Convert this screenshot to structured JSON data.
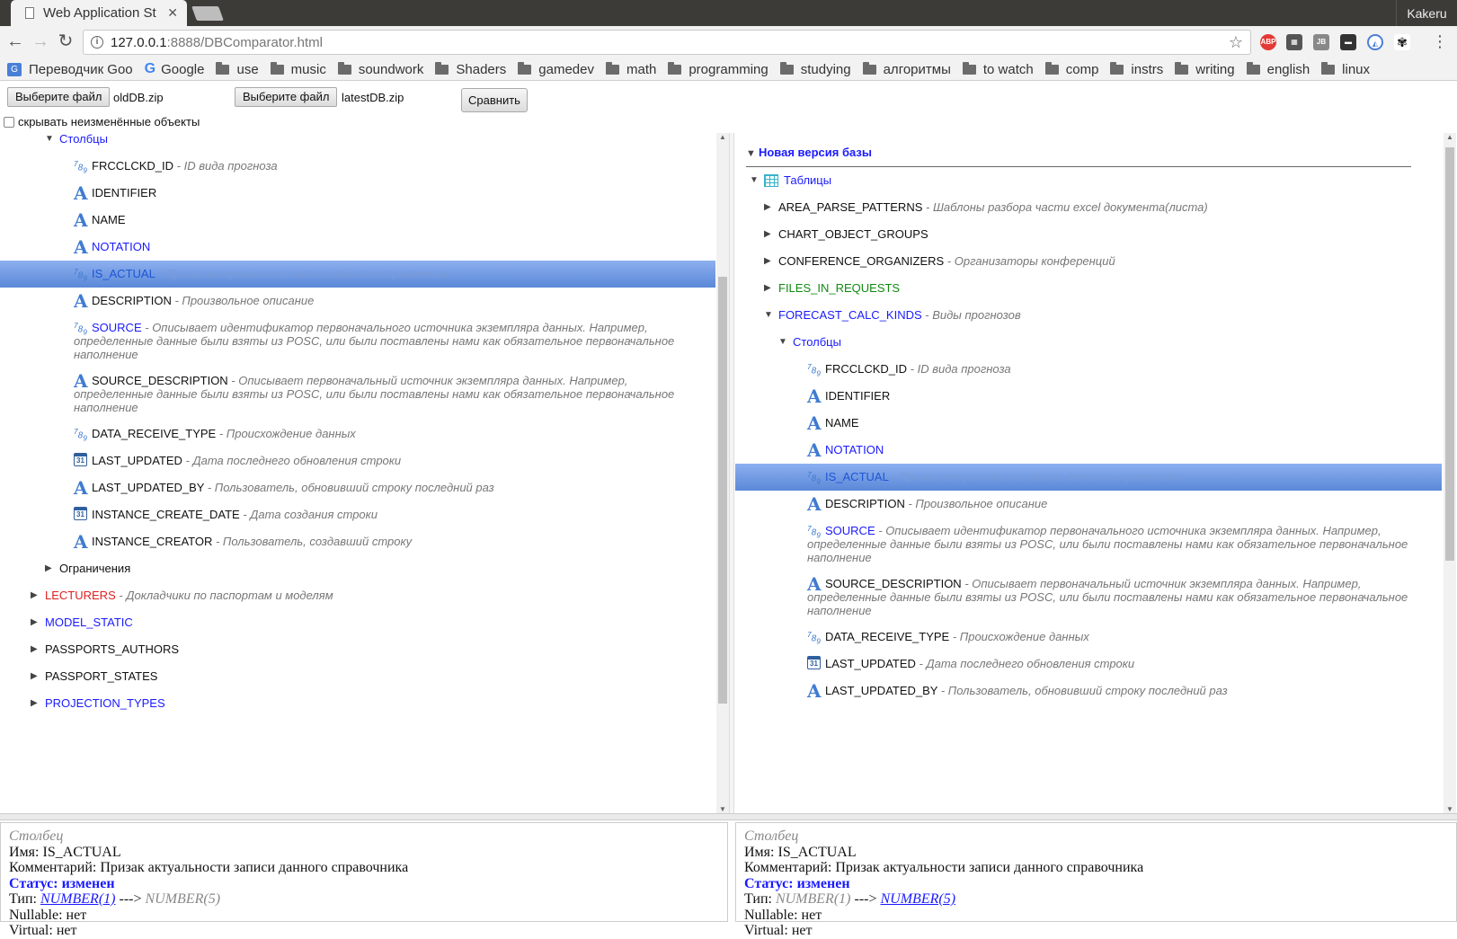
{
  "browser": {
    "tab_title": "Web Application St",
    "profile": "Kakeru",
    "url_host": "127.0.0.1",
    "url_rest": ":8888/DBComparator.html",
    "bookmarks": [
      "Переводчик Goo",
      "Google",
      "use",
      "music",
      "soundwork",
      "Shaders",
      "gamedev",
      "math",
      "programming",
      "studying",
      "алгоритмы",
      "to watch",
      "comp",
      "instrs",
      "writing",
      "english",
      "linux"
    ]
  },
  "controls": {
    "choose_file_1": "Выберите файл",
    "file_1": "oldDB.zip",
    "choose_file_2": "Выберите файл",
    "file_2": "latestDB.zip",
    "compare": "Сравнить",
    "hide_unchanged": "скрывать неизменённые объекты"
  },
  "left_tree": {
    "columns_folder": "Столбцы",
    "columns": [
      {
        "icon": "num",
        "name": "FRCCLCKD_ID",
        "comment": "- ID вида прогноза"
      },
      {
        "icon": "A",
        "name": "IDENTIFIER",
        "comment": ""
      },
      {
        "icon": "A",
        "name": "NAME",
        "comment": ""
      },
      {
        "icon": "A",
        "name": "NOTATION",
        "comment": ""
      },
      {
        "icon": "num",
        "name": "IS_ACTUAL",
        "comment": "- Призак актуальности записи данного справочника"
      },
      {
        "icon": "A",
        "name": "DESCRIPTION",
        "comment": "- Произвольное описание"
      },
      {
        "icon": "num",
        "name": "SOURCE",
        "comment": "- Описывает идентификатор первоначального источника экземпляра данных. Например, определенные данные были взяты из POSC, или были поставлены нами как обязательное первоначальное наполнение"
      },
      {
        "icon": "A",
        "name": "SOURCE_DESCRIPTION",
        "comment": "- Описывает первоначальный источник экземпляра данных. Например, определенные данные были взяты из POSC, или были поставлены нами как обязательное первоначальное наполнение"
      },
      {
        "icon": "num",
        "name": "DATA_RECEIVE_TYPE",
        "comment": "- Происхождение данных"
      },
      {
        "icon": "cal",
        "name": "LAST_UPDATED",
        "comment": "- Дата последнего обновления строки"
      },
      {
        "icon": "A",
        "name": "LAST_UPDATED_BY",
        "comment": "- Пользователь, обновивший строку последний раз"
      },
      {
        "icon": "cal",
        "name": "INSTANCE_CREATE_DATE",
        "comment": "- Дата создания строки"
      },
      {
        "icon": "A",
        "name": "INSTANCE_CREATOR",
        "comment": "- Пользователь, создавший строку"
      }
    ],
    "constraints_folder": "Ограничения",
    "tables": [
      {
        "name": "LECTURERS",
        "comment": "- Докладчики по паспортам и моделям",
        "state": "removed"
      },
      {
        "name": "MODEL_STATIC",
        "comment": "",
        "state": "changed"
      },
      {
        "name": "PASSPORTS_AUTHORS",
        "comment": "",
        "state": "same"
      },
      {
        "name": "PASSPORT_STATES",
        "comment": "",
        "state": "same"
      },
      {
        "name": "PROJECTION_TYPES",
        "comment": "",
        "state": "changed"
      }
    ]
  },
  "right_tree": {
    "section_title": "Новая версия базы",
    "tables_folder": "Таблицы",
    "tables": [
      {
        "name": "AREA_PARSE_PATTERNS",
        "comment": "- Шаблоны разбора части excel документа(листа)",
        "state": "same"
      },
      {
        "name": "CHART_OBJECT_GROUPS",
        "comment": "",
        "state": "same"
      },
      {
        "name": "CONFERENCE_ORGANIZERS",
        "comment": "- Организаторы конференций",
        "state": "same"
      },
      {
        "name": "FILES_IN_REQUESTS",
        "comment": "",
        "state": "added"
      },
      {
        "name": "FORECAST_CALC_KINDS",
        "comment": "- Виды прогнозов",
        "state": "changed"
      }
    ],
    "columns_folder": "Столбцы",
    "columns": [
      {
        "icon": "num",
        "name": "FRCCLCKD_ID",
        "comment": "- ID вида прогноза"
      },
      {
        "icon": "A",
        "name": "IDENTIFIER",
        "comment": ""
      },
      {
        "icon": "A",
        "name": "NAME",
        "comment": ""
      },
      {
        "icon": "A",
        "name": "NOTATION",
        "comment": ""
      },
      {
        "icon": "num",
        "name": "IS_ACTUAL",
        "comment": "- Призак актуальности записи данного справочника"
      },
      {
        "icon": "A",
        "name": "DESCRIPTION",
        "comment": "- Произвольное описание"
      },
      {
        "icon": "num",
        "name": "SOURCE",
        "comment": "- Описывает идентификатор первоначального источника экземпляра данных. Например, определенные данные были взяты из POSC, или были поставлены нами как обязательное первоначальное наполнение"
      },
      {
        "icon": "A",
        "name": "SOURCE_DESCRIPTION",
        "comment": "- Описывает первоначальный источник экземпляра данных. Например, определенные данные были взяты из POSC, или были поставлены нами как обязательное первоначальное наполнение"
      },
      {
        "icon": "num",
        "name": "DATA_RECEIVE_TYPE",
        "comment": "- Происхождение данных"
      },
      {
        "icon": "cal",
        "name": "LAST_UPDATED",
        "comment": "- Дата последнего обновления строки"
      },
      {
        "icon": "A",
        "name": "LAST_UPDATED_BY",
        "comment": "- Пользователь, обновивший строку последний раз"
      }
    ]
  },
  "details": {
    "kind": "Столбец",
    "name_label": "Имя:",
    "name_value": "IS_ACTUAL",
    "comment_label": "Комментарий:",
    "comment_value": "Призак актуальности записи данного справочника",
    "status_label": "Статус:",
    "status_value": "изменен",
    "type_label": "Тип:",
    "type_old": "NUMBER(1)",
    "arrow": "--->",
    "type_new": "NUMBER(5)",
    "nullable_label": "Nullable:",
    "nullable_value": "нет",
    "virtual_label": "Virtual:",
    "virtual_value": "нет"
  },
  "colors": {
    "changed": "#1a1aff",
    "removed": "#e02020",
    "added": "#108a10",
    "selected": "#5a88d8"
  }
}
